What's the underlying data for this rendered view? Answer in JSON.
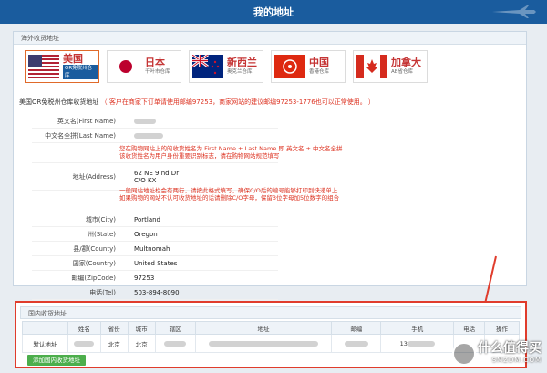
{
  "header": {
    "title": "我的地址"
  },
  "overseas": {
    "panel_title": "海外收货地址",
    "countries": [
      {
        "name": "美国",
        "sub": "OR免税州仓库",
        "active": true
      },
      {
        "name": "日本",
        "sub": "千叶市仓库",
        "active": false
      },
      {
        "name": "新西兰",
        "sub": "奥克兰仓库",
        "active": false
      },
      {
        "name": "中国",
        "sub": "香港仓库",
        "active": false
      },
      {
        "name": "加拿大",
        "sub": "AB省仓库",
        "active": false
      }
    ],
    "section_label": "美国OR免税州仓库收货地址",
    "section_note": "（ 客户在商家下订单请使用邮编97253，商家网站的建议邮编97253-1776也可以正常使用。 ）"
  },
  "address": {
    "first_name_label": "英文名(First Name)",
    "last_name_label": "中文名全拼(Last Name)",
    "name_note_1": "您在购物网站上的的收货姓名为 First Name + Last Name 即 英文名 + 中文名全拼",
    "name_note_2": "该收货姓名为用户身份重要识别标志，请在购物网站规范填写",
    "address_label": "地址(Address)",
    "address_line1": "62   NE 9   nd Dr",
    "address_line2": "C/O KX",
    "address_note_1": "一般网站地址栏会有两行，请按此格式填写，确保C/O后的编号能够打印到快递单上",
    "address_note_2": "如果购物的网站不认可收货地址的话请删除C/O字母，保留3位字母加5位数字的组合",
    "city_label": "城市(City)",
    "city": "Portland",
    "state_label": "州(State)",
    "state": "Oregon",
    "county_label": "县/郡(County)",
    "county": "Multnomah",
    "country_label": "国家(Country)",
    "country": "United States",
    "zip_label": "邮编(ZipCode)",
    "zip": "97253",
    "tel_label": "电话(Tel)",
    "tel": "503-894-8090"
  },
  "domestic": {
    "panel_title": "国内收货地址",
    "columns": [
      "",
      "姓名",
      "省份",
      "城市",
      "辖区",
      "地址",
      "邮编",
      "手机",
      "电话",
      "操作"
    ],
    "row": {
      "default_label": "默认地址",
      "province": "北京",
      "city": "北京",
      "phone_prefix": "13"
    },
    "add_button": "添加国内收货地址"
  },
  "watermark": {
    "line1": "什么值得买",
    "line2": "SMZDM.COM"
  },
  "colors": {
    "header_bg": "#1a5c9e",
    "highlight_border": "#e03c2c",
    "note_red": "#d32222",
    "add_button": "#4cae4c"
  }
}
